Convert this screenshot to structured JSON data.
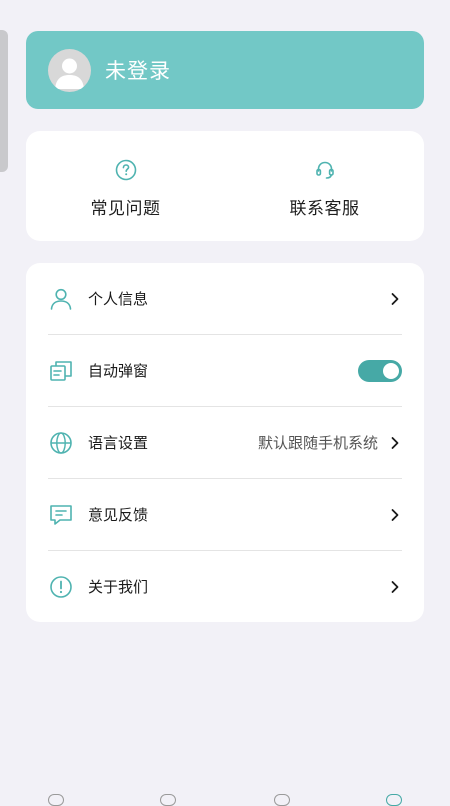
{
  "header": {
    "login_status": "未登录",
    "avatar_icon": "default-user-avatar",
    "background": "#72c8c6"
  },
  "quick_actions": [
    {
      "label": "常见问题",
      "icon": "help-circle-icon"
    },
    {
      "label": "联系客服",
      "icon": "headset-icon"
    }
  ],
  "menu": {
    "items": [
      {
        "label": "个人信息",
        "icon": "user-icon",
        "control": "chevron"
      },
      {
        "label": "自动弹窗",
        "icon": "popup-window-icon",
        "control": "toggle",
        "toggle_on": true
      },
      {
        "label": "语言设置",
        "icon": "globe-icon",
        "value": "默认跟随手机系统",
        "control": "chevron"
      },
      {
        "label": "意见反馈",
        "icon": "feedback-icon",
        "control": "chevron"
      },
      {
        "label": "关于我们",
        "icon": "info-icon",
        "control": "chevron"
      }
    ]
  },
  "colors": {
    "accent": "#46a9a6",
    "icon_teal": "#4fb3b0",
    "page_background": "#f2f1f7"
  }
}
